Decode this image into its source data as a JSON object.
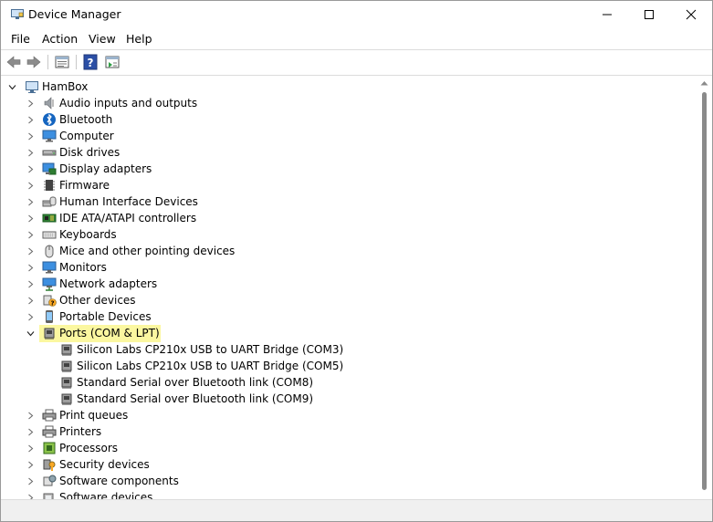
{
  "window": {
    "title": "Device Manager"
  },
  "menu": [
    "File",
    "Action",
    "View",
    "Help"
  ],
  "toolbar": [
    "back-icon",
    "forward-icon",
    "properties-icon",
    "help-icon",
    "update-driver-icon"
  ],
  "tree": {
    "root": {
      "label": "HamBox",
      "expanded": true
    },
    "categories": [
      {
        "label": "Audio inputs and outputs",
        "icon": "speaker-icon",
        "expanded": false
      },
      {
        "label": "Bluetooth",
        "icon": "bluetooth-icon",
        "expanded": false
      },
      {
        "label": "Computer",
        "icon": "monitor-icon",
        "expanded": false
      },
      {
        "label": "Disk drives",
        "icon": "disk-drive-icon",
        "expanded": false
      },
      {
        "label": "Display adapters",
        "icon": "display-adapter-icon",
        "expanded": false
      },
      {
        "label": "Firmware",
        "icon": "firmware-chip-icon",
        "expanded": false
      },
      {
        "label": "Human Interface Devices",
        "icon": "hid-icon",
        "expanded": false
      },
      {
        "label": "IDE ATA/ATAPI controllers",
        "icon": "ide-controller-icon",
        "expanded": false
      },
      {
        "label": "Keyboards",
        "icon": "keyboard-icon",
        "expanded": false
      },
      {
        "label": "Mice and other pointing devices",
        "icon": "mouse-icon",
        "expanded": false
      },
      {
        "label": "Monitors",
        "icon": "monitor-icon",
        "expanded": false
      },
      {
        "label": "Network adapters",
        "icon": "network-adapter-icon",
        "expanded": false
      },
      {
        "label": "Other devices",
        "icon": "other-devices-icon",
        "expanded": false
      },
      {
        "label": "Portable Devices",
        "icon": "portable-device-icon",
        "expanded": false
      },
      {
        "label": "Ports (COM & LPT)",
        "icon": "port-icon",
        "expanded": true,
        "highlighted": true,
        "children": [
          {
            "label": "Silicon Labs CP210x USB to UART Bridge (COM3)",
            "icon": "port-icon"
          },
          {
            "label": "Silicon Labs CP210x USB to UART Bridge (COM5)",
            "icon": "port-icon"
          },
          {
            "label": "Standard Serial over Bluetooth link (COM8)",
            "icon": "port-icon"
          },
          {
            "label": "Standard Serial over Bluetooth link (COM9)",
            "icon": "port-icon"
          }
        ]
      },
      {
        "label": "Print queues",
        "icon": "printer-icon",
        "expanded": false
      },
      {
        "label": "Printers",
        "icon": "printer-icon",
        "expanded": false
      },
      {
        "label": "Processors",
        "icon": "processor-icon",
        "expanded": false
      },
      {
        "label": "Security devices",
        "icon": "security-device-icon",
        "expanded": false
      },
      {
        "label": "Software components",
        "icon": "software-component-icon",
        "expanded": false
      },
      {
        "label": "Software devices",
        "icon": "software-device-icon",
        "expanded": false
      }
    ]
  },
  "colors": {
    "highlight": "#fbf7a0",
    "accent": "#0063b1"
  }
}
